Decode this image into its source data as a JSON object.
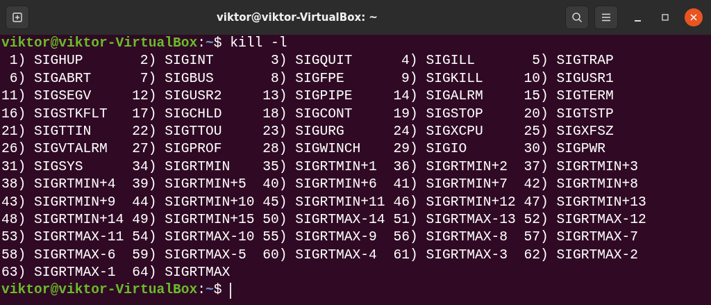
{
  "window": {
    "title": "viktor@viktor-VirtualBox: ~"
  },
  "terminal": {
    "lines": [
      {
        "kind": "prompt",
        "user_host": "viktor@viktor-VirtualBox",
        "separator": ":",
        "path": "~",
        "symbol": "$",
        "command": "kill -l"
      },
      {
        "kind": "signals",
        "entries": [
          {
            "num": "1)",
            "name": "SIGHUP"
          },
          {
            "num": "2)",
            "name": "SIGINT"
          },
          {
            "num": "3)",
            "name": "SIGQUIT"
          },
          {
            "num": "4)",
            "name": "SIGILL"
          },
          {
            "num": "5)",
            "name": "SIGTRAP"
          }
        ]
      },
      {
        "kind": "signals",
        "entries": [
          {
            "num": "6)",
            "name": "SIGABRT"
          },
          {
            "num": "7)",
            "name": "SIGBUS"
          },
          {
            "num": "8)",
            "name": "SIGFPE"
          },
          {
            "num": "9)",
            "name": "SIGKILL"
          },
          {
            "num": "10)",
            "name": "SIGUSR1"
          }
        ]
      },
      {
        "kind": "signals",
        "entries": [
          {
            "num": "11)",
            "name": "SIGSEGV"
          },
          {
            "num": "12)",
            "name": "SIGUSR2"
          },
          {
            "num": "13)",
            "name": "SIGPIPE"
          },
          {
            "num": "14)",
            "name": "SIGALRM"
          },
          {
            "num": "15)",
            "name": "SIGTERM"
          }
        ]
      },
      {
        "kind": "signals",
        "entries": [
          {
            "num": "16)",
            "name": "SIGSTKFLT"
          },
          {
            "num": "17)",
            "name": "SIGCHLD"
          },
          {
            "num": "18)",
            "name": "SIGCONT"
          },
          {
            "num": "19)",
            "name": "SIGSTOP"
          },
          {
            "num": "20)",
            "name": "SIGTSTP"
          }
        ]
      },
      {
        "kind": "signals",
        "entries": [
          {
            "num": "21)",
            "name": "SIGTTIN"
          },
          {
            "num": "22)",
            "name": "SIGTTOU"
          },
          {
            "num": "23)",
            "name": "SIGURG"
          },
          {
            "num": "24)",
            "name": "SIGXCPU"
          },
          {
            "num": "25)",
            "name": "SIGXFSZ"
          }
        ]
      },
      {
        "kind": "signals",
        "entries": [
          {
            "num": "26)",
            "name": "SIGVTALRM"
          },
          {
            "num": "27)",
            "name": "SIGPROF"
          },
          {
            "num": "28)",
            "name": "SIGWINCH"
          },
          {
            "num": "29)",
            "name": "SIGIO"
          },
          {
            "num": "30)",
            "name": "SIGPWR"
          }
        ]
      },
      {
        "kind": "signals",
        "entries": [
          {
            "num": "31)",
            "name": "SIGSYS"
          },
          {
            "num": "34)",
            "name": "SIGRTMIN"
          },
          {
            "num": "35)",
            "name": "SIGRTMIN+1"
          },
          {
            "num": "36)",
            "name": "SIGRTMIN+2"
          },
          {
            "num": "37)",
            "name": "SIGRTMIN+3"
          }
        ]
      },
      {
        "kind": "signals",
        "entries": [
          {
            "num": "38)",
            "name": "SIGRTMIN+4"
          },
          {
            "num": "39)",
            "name": "SIGRTMIN+5"
          },
          {
            "num": "40)",
            "name": "SIGRTMIN+6"
          },
          {
            "num": "41)",
            "name": "SIGRTMIN+7"
          },
          {
            "num": "42)",
            "name": "SIGRTMIN+8"
          }
        ]
      },
      {
        "kind": "signals",
        "entries": [
          {
            "num": "43)",
            "name": "SIGRTMIN+9"
          },
          {
            "num": "44)",
            "name": "SIGRTMIN+10"
          },
          {
            "num": "45)",
            "name": "SIGRTMIN+11"
          },
          {
            "num": "46)",
            "name": "SIGRTMIN+12"
          },
          {
            "num": "47)",
            "name": "SIGRTMIN+13"
          }
        ]
      },
      {
        "kind": "signals",
        "entries": [
          {
            "num": "48)",
            "name": "SIGRTMIN+14"
          },
          {
            "num": "49)",
            "name": "SIGRTMIN+15"
          },
          {
            "num": "50)",
            "name": "SIGRTMAX-14"
          },
          {
            "num": "51)",
            "name": "SIGRTMAX-13"
          },
          {
            "num": "52)",
            "name": "SIGRTMAX-12"
          }
        ]
      },
      {
        "kind": "signals",
        "entries": [
          {
            "num": "53)",
            "name": "SIGRTMAX-11"
          },
          {
            "num": "54)",
            "name": "SIGRTMAX-10"
          },
          {
            "num": "55)",
            "name": "SIGRTMAX-9"
          },
          {
            "num": "56)",
            "name": "SIGRTMAX-8"
          },
          {
            "num": "57)",
            "name": "SIGRTMAX-7"
          }
        ]
      },
      {
        "kind": "signals",
        "entries": [
          {
            "num": "58)",
            "name": "SIGRTMAX-6"
          },
          {
            "num": "59)",
            "name": "SIGRTMAX-5"
          },
          {
            "num": "60)",
            "name": "SIGRTMAX-4"
          },
          {
            "num": "61)",
            "name": "SIGRTMAX-3"
          },
          {
            "num": "62)",
            "name": "SIGRTMAX-2"
          }
        ]
      },
      {
        "kind": "signals",
        "entries": [
          {
            "num": "63)",
            "name": "SIGRTMAX-1"
          },
          {
            "num": "64)",
            "name": "SIGRTMAX"
          }
        ]
      },
      {
        "kind": "prompt",
        "user_host": "viktor@viktor-VirtualBox",
        "separator": ":",
        "path": "~",
        "symbol": "$",
        "cursor": true
      }
    ]
  }
}
